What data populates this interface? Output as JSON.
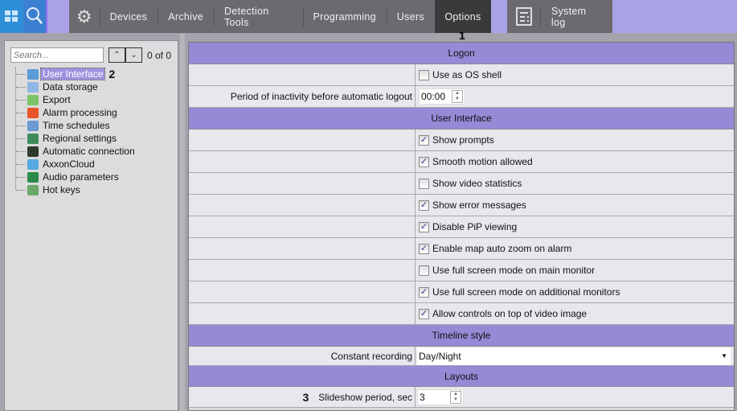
{
  "topbar": {
    "nav": [
      "Devices",
      "Archive",
      "Detection Tools",
      "Programming",
      "Users",
      "Options"
    ],
    "active": "Options",
    "system_log": "System log",
    "marker": "1"
  },
  "sidebar": {
    "search_placeholder": "Search...",
    "counter": "0 of 0",
    "marker": "2",
    "items": [
      {
        "label": "User Interface",
        "icon": "window-icon",
        "color": "#5a9bd8"
      },
      {
        "label": "Data storage",
        "icon": "storage-icon",
        "color": "#8fb6e6"
      },
      {
        "label": "Export",
        "icon": "export-icon",
        "color": "#7cc46a"
      },
      {
        "label": "Alarm processing",
        "icon": "alarm-bell-icon",
        "color": "#e8552a"
      },
      {
        "label": "Time schedules",
        "icon": "clock-icon",
        "color": "#6a9ad0"
      },
      {
        "label": "Regional settings",
        "icon": "globe-icon",
        "color": "#3f8a5a"
      },
      {
        "label": "Automatic connection",
        "icon": "connection-icon",
        "color": "#2d3a2d"
      },
      {
        "label": "AxxonCloud",
        "icon": "cloud-icon",
        "color": "#58a8e0"
      },
      {
        "label": "Audio parameters",
        "icon": "speaker-icon",
        "color": "#2a8a4a"
      },
      {
        "label": "Hot keys",
        "icon": "keyboard-icon",
        "color": "#6aa86a"
      }
    ]
  },
  "settings": {
    "logon": {
      "header": "Logon",
      "use_as_os_shell": {
        "label": "Use as OS shell",
        "checked": false
      },
      "inactivity": {
        "label": "Period of inactivity before automatic logout",
        "value": "00:00"
      }
    },
    "ui": {
      "header": "User Interface",
      "options": [
        {
          "label": "Show prompts",
          "checked": true
        },
        {
          "label": "Smooth motion allowed",
          "checked": true
        },
        {
          "label": "Show video statistics",
          "checked": false
        },
        {
          "label": "Show error messages",
          "checked": true
        },
        {
          "label": "Disable PiP viewing",
          "checked": true
        },
        {
          "label": "Enable map auto zoom on alarm",
          "checked": true
        },
        {
          "label": "Use full screen mode on main monitor",
          "checked": false
        },
        {
          "label": "Use full screen mode on additional monitors",
          "checked": true
        },
        {
          "label": "Allow controls on top of video image",
          "checked": true
        }
      ]
    },
    "timeline": {
      "header": "Timeline style",
      "label": "Constant recording",
      "value": "Day/Night"
    },
    "layouts": {
      "header": "Layouts",
      "label": "Slideshow period, sec",
      "value": "3",
      "marker": "3"
    }
  }
}
